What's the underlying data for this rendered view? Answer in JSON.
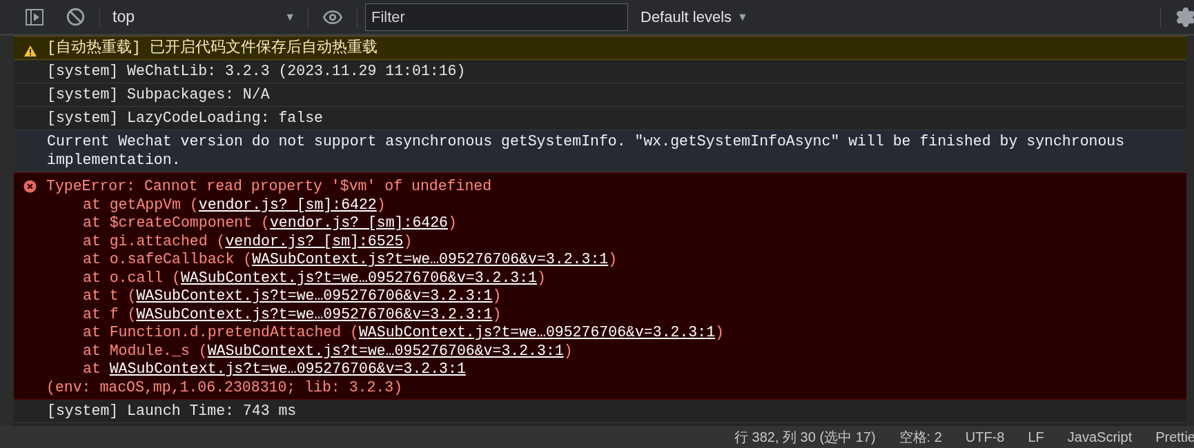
{
  "toolbar": {
    "context": "top",
    "filter": {
      "placeholder": "Filter"
    },
    "levels": "Default levels",
    "levels_caret": "▼",
    "context_caret": "▼"
  },
  "messages": [
    {
      "kind": "warning",
      "text": "[自动热重载] 已开启代码文件保存后自动热重载"
    },
    {
      "kind": "info",
      "text": "[system] WeChatLib: 3.2.3 (2023.11.29 11:01:16)"
    },
    {
      "kind": "info",
      "text": "[system] Subpackages: N/A"
    },
    {
      "kind": "info",
      "text": "[system] LazyCodeLoading: false"
    },
    {
      "kind": "verbose",
      "text": "Current Wechat version do not support asynchronous getSystemInfo. \"wx.getSystemInfoAsync\" will be finished by synchronous implementation."
    },
    {
      "kind": "error",
      "text": "TypeError: Cannot read property '$vm' of undefined",
      "frames": [
        {
          "prefix": "at getAppVm (",
          "link": "vendor.js? [sm]:6422",
          "suffix": ")"
        },
        {
          "prefix": "at $createComponent (",
          "link": "vendor.js? [sm]:6426",
          "suffix": ")"
        },
        {
          "prefix": "at gi.attached (",
          "link": "vendor.js? [sm]:6525",
          "suffix": ")"
        },
        {
          "prefix": "at o.safeCallback (",
          "link": "WASubContext.js?t=we…095276706&v=3.2.3:1",
          "suffix": ")"
        },
        {
          "prefix": "at o.call (",
          "link": "WASubContext.js?t=we…095276706&v=3.2.3:1",
          "suffix": ")"
        },
        {
          "prefix": "at t (",
          "link": "WASubContext.js?t=we…095276706&v=3.2.3:1",
          "suffix": ")"
        },
        {
          "prefix": "at f (",
          "link": "WASubContext.js?t=we…095276706&v=3.2.3:1",
          "suffix": ")"
        },
        {
          "prefix": "at Function.d.pretendAttached (",
          "link": "WASubContext.js?t=we…095276706&v=3.2.3:1",
          "suffix": ")"
        },
        {
          "prefix": "at Module._s (",
          "link": "WASubContext.js?t=we…095276706&v=3.2.3:1",
          "suffix": ")"
        },
        {
          "prefix": "at ",
          "link": "WASubContext.js?t=we…095276706&v=3.2.3:1"
        }
      ],
      "env": "(env: macOS,mp,1.06.2308310; lib: 3.2.3)"
    },
    {
      "kind": "info",
      "text": "[system] Launch Time: 743 ms"
    }
  ],
  "status_bar": [
    "行 382, 列 30 (选中 17)",
    "空格: 2",
    "UTF-8",
    "LF",
    "JavaScript",
    "Prettie"
  ]
}
